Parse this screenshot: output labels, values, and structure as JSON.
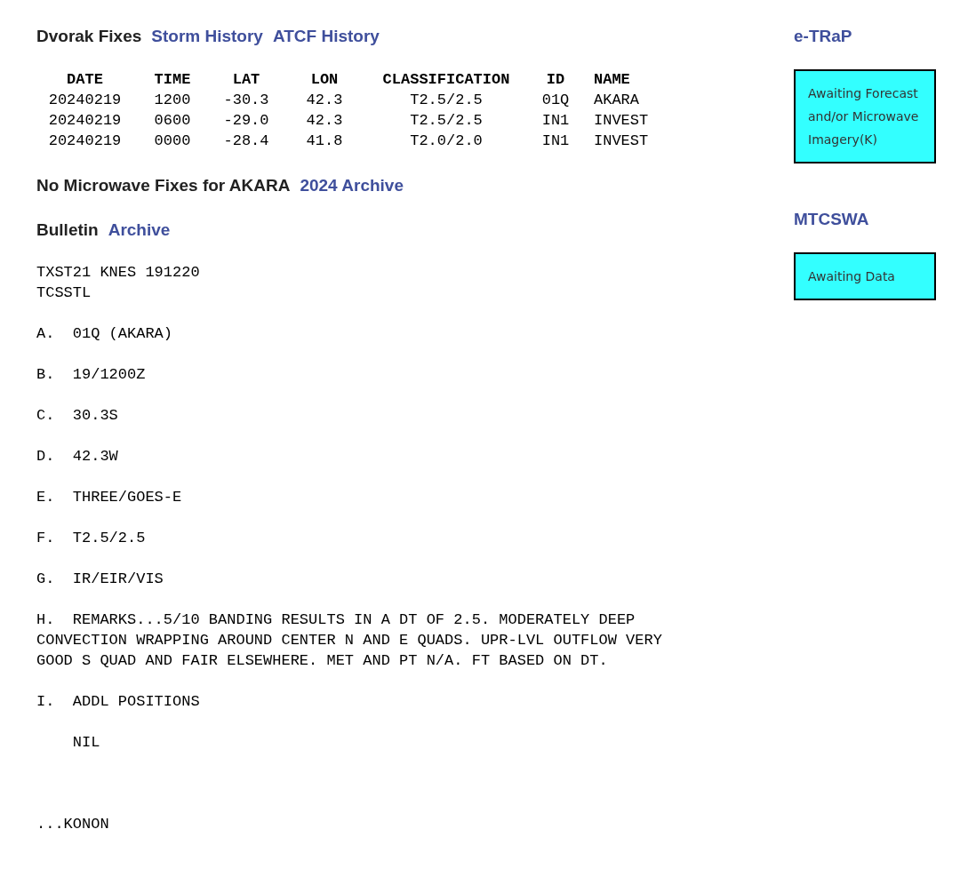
{
  "header": {
    "title": "Dvorak Fixes",
    "links": [
      "Storm History",
      "ATCF History"
    ]
  },
  "dvorak_table": {
    "columns": [
      "DATE",
      "TIME",
      "LAT",
      "LON",
      "CLASSIFICATION",
      "ID",
      "NAME"
    ],
    "rows": [
      [
        "20240219",
        "1200",
        "-30.3",
        "42.3",
        "T2.5/2.5",
        "01Q",
        "AKARA"
      ],
      [
        "20240219",
        "0600",
        "-29.0",
        "42.3",
        "T2.5/2.5",
        "IN1",
        "INVEST"
      ],
      [
        "20240219",
        "0000",
        "-28.4",
        "41.8",
        "T2.0/2.0",
        "IN1",
        "INVEST"
      ]
    ]
  },
  "microwave": {
    "text": "No Microwave Fixes for AKARA",
    "links": [
      "2024 Archive"
    ]
  },
  "bulletin": {
    "title": "Bulletin",
    "links": [
      "Archive"
    ],
    "paragraphs": [
      "TXST21 KNES 191220\nTCSSTL",
      "A.  01Q (AKARA)",
      "B.  19/1200Z",
      "C.  30.3S",
      "D.  42.3W",
      "E.  THREE/GOES-E",
      "F.  T2.5/2.5",
      "G.  IR/EIR/VIS",
      "H.  REMARKS...5/10 BANDING RESULTS IN A DT OF 2.5. MODERATELY DEEP\nCONVECTION WRAPPING AROUND CENTER N AND E QUADS. UPR-LVL OUTFLOW VERY\nGOOD S QUAD AND FAIR ELSEWHERE. MET AND PT N/A. FT BASED ON DT.",
      "I.  ADDL POSITIONS",
      "    NIL"
    ],
    "signature": "...KONON"
  },
  "sidebar": [
    {
      "title": "e-TRaP",
      "message": "Awaiting Forecast and/or Microwave Imagery(K)"
    },
    {
      "title": "MTCSWA",
      "message": "Awaiting Data"
    }
  ]
}
